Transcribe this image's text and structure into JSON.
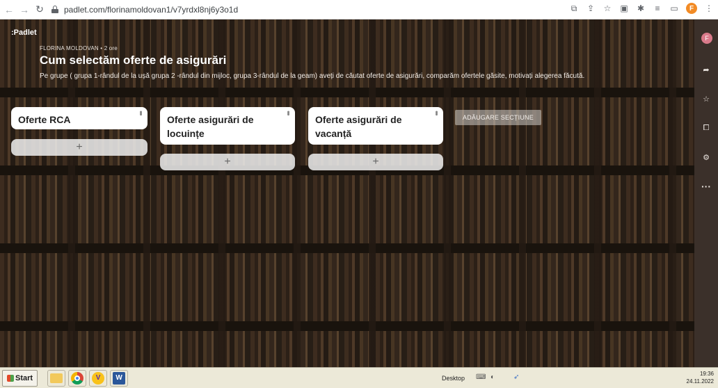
{
  "browser": {
    "url": "padlet.com/florinamoldovan1/v7yrdxl8nj6y3o1d",
    "profile_initial": "F",
    "nav_icons": [
      "back-icon",
      "forward-icon",
      "reload-icon"
    ]
  },
  "padlet": {
    "logo": ":Padlet",
    "author": "FLORINA MOLDOVAN • 2 ore",
    "title": "Cum selectăm oferte de asigurări",
    "description": "Pe grupe ( grupa 1-rândul de la ușă grupa 2 -rândul din mijloc, grupa 3-rândul de la geam) aveți de căutat oferte de asigurări, comparăm ofertele găsite, motivați alegerea făcută.",
    "sections": [
      {
        "title": "Oferte RCA",
        "add": "+"
      },
      {
        "title": "Oferte asigurări de locuințe",
        "add": "+"
      },
      {
        "title": "Oferte asigurări de vacanță",
        "add": "+"
      }
    ],
    "add_section_label": "ADĂUGARE SECȚIUNE"
  },
  "sidebar": {
    "avatar_initial": "F",
    "items": [
      "share-icon",
      "star-icon",
      "remake-icon",
      "settings-icon",
      "more-icon"
    ]
  },
  "taskbar": {
    "start_label": "Start",
    "desktop_label": "Desktop",
    "time": "19:36",
    "date": "24.11.2022",
    "word_letter": "W"
  }
}
